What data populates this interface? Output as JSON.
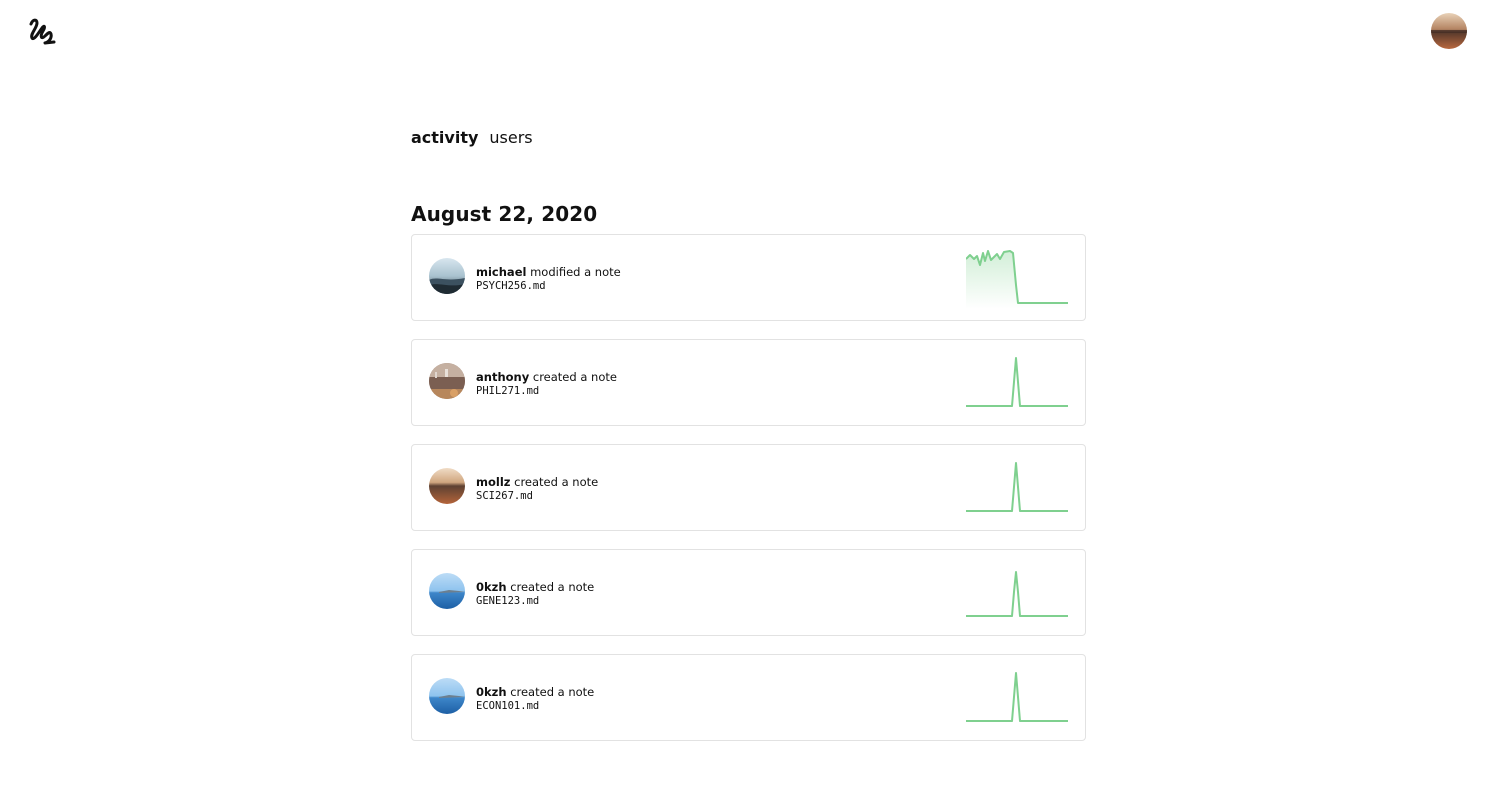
{
  "header": {
    "logo_icon": "squiggle-logo-icon",
    "profile_avatar": "profile-avatar"
  },
  "tabs": [
    {
      "label": "activity",
      "active": true
    },
    {
      "label": "users",
      "active": false
    }
  ],
  "date_heading": "August 22, 2020",
  "accent_color": "#7fd08f",
  "activities": [
    {
      "user": "michael",
      "action": "modified a note",
      "file": "PSYCH256.md",
      "avatar": "coast-photo-avatar",
      "graph": "plateau"
    },
    {
      "user": "anthony",
      "action": "created a note",
      "file": "PHIL271.md",
      "avatar": "room-photo-avatar",
      "graph": "spike"
    },
    {
      "user": "mollz",
      "action": "created a note",
      "file": "SCI267.md",
      "avatar": "sunset-photo-avatar",
      "graph": "spike"
    },
    {
      "user": "0kzh",
      "action": "created a note",
      "file": "GENE123.md",
      "avatar": "sea-photo-avatar",
      "graph": "spike"
    },
    {
      "user": "0kzh",
      "action": "created a note",
      "file": "ECON101.md",
      "avatar": "sea-photo-avatar",
      "graph": "spike"
    }
  ]
}
